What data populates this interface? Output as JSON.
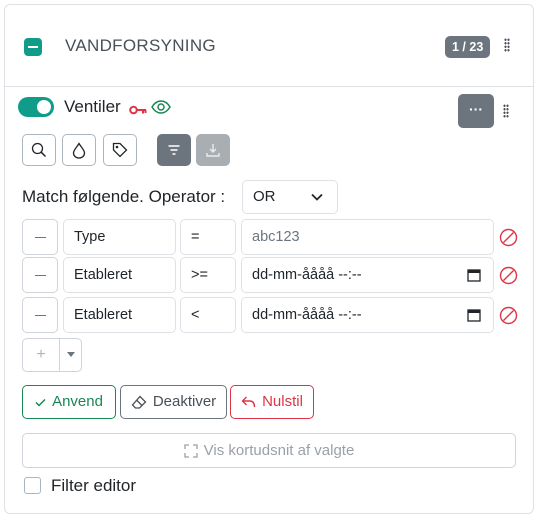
{
  "group": {
    "title": "VANDFORSYNING",
    "count": "1 / 23"
  },
  "layer": {
    "name": "Ventiler",
    "enabled": true,
    "more_label": "···"
  },
  "toolbar": {
    "icons": [
      "search-icon",
      "drop-icon",
      "tag-icon",
      "filter-icon",
      "download-icon"
    ]
  },
  "match": {
    "label": "Match følgende. Operator :",
    "operator": "OR"
  },
  "filters": [
    {
      "field": "Type",
      "op": "=",
      "value": "abc123",
      "is_date": false
    },
    {
      "field": "Etableret",
      "op": ">=",
      "value": "dd-mm-åååå --:--",
      "is_date": true
    },
    {
      "field": "Etableret",
      "op": "<",
      "value": "dd-mm-åååå --:--",
      "is_date": true
    }
  ],
  "add_label": "+",
  "actions": {
    "apply": "Anvend",
    "deactivate": "Deaktiver",
    "reset": "Nulstil"
  },
  "zoom_label": "Vis kortudsnit af valgte",
  "filter_editor_label": "Filter editor",
  "colors": {
    "teal": "#0f9d8a",
    "secondary": "#6c757d",
    "success": "#198754",
    "danger": "#dc3545"
  }
}
